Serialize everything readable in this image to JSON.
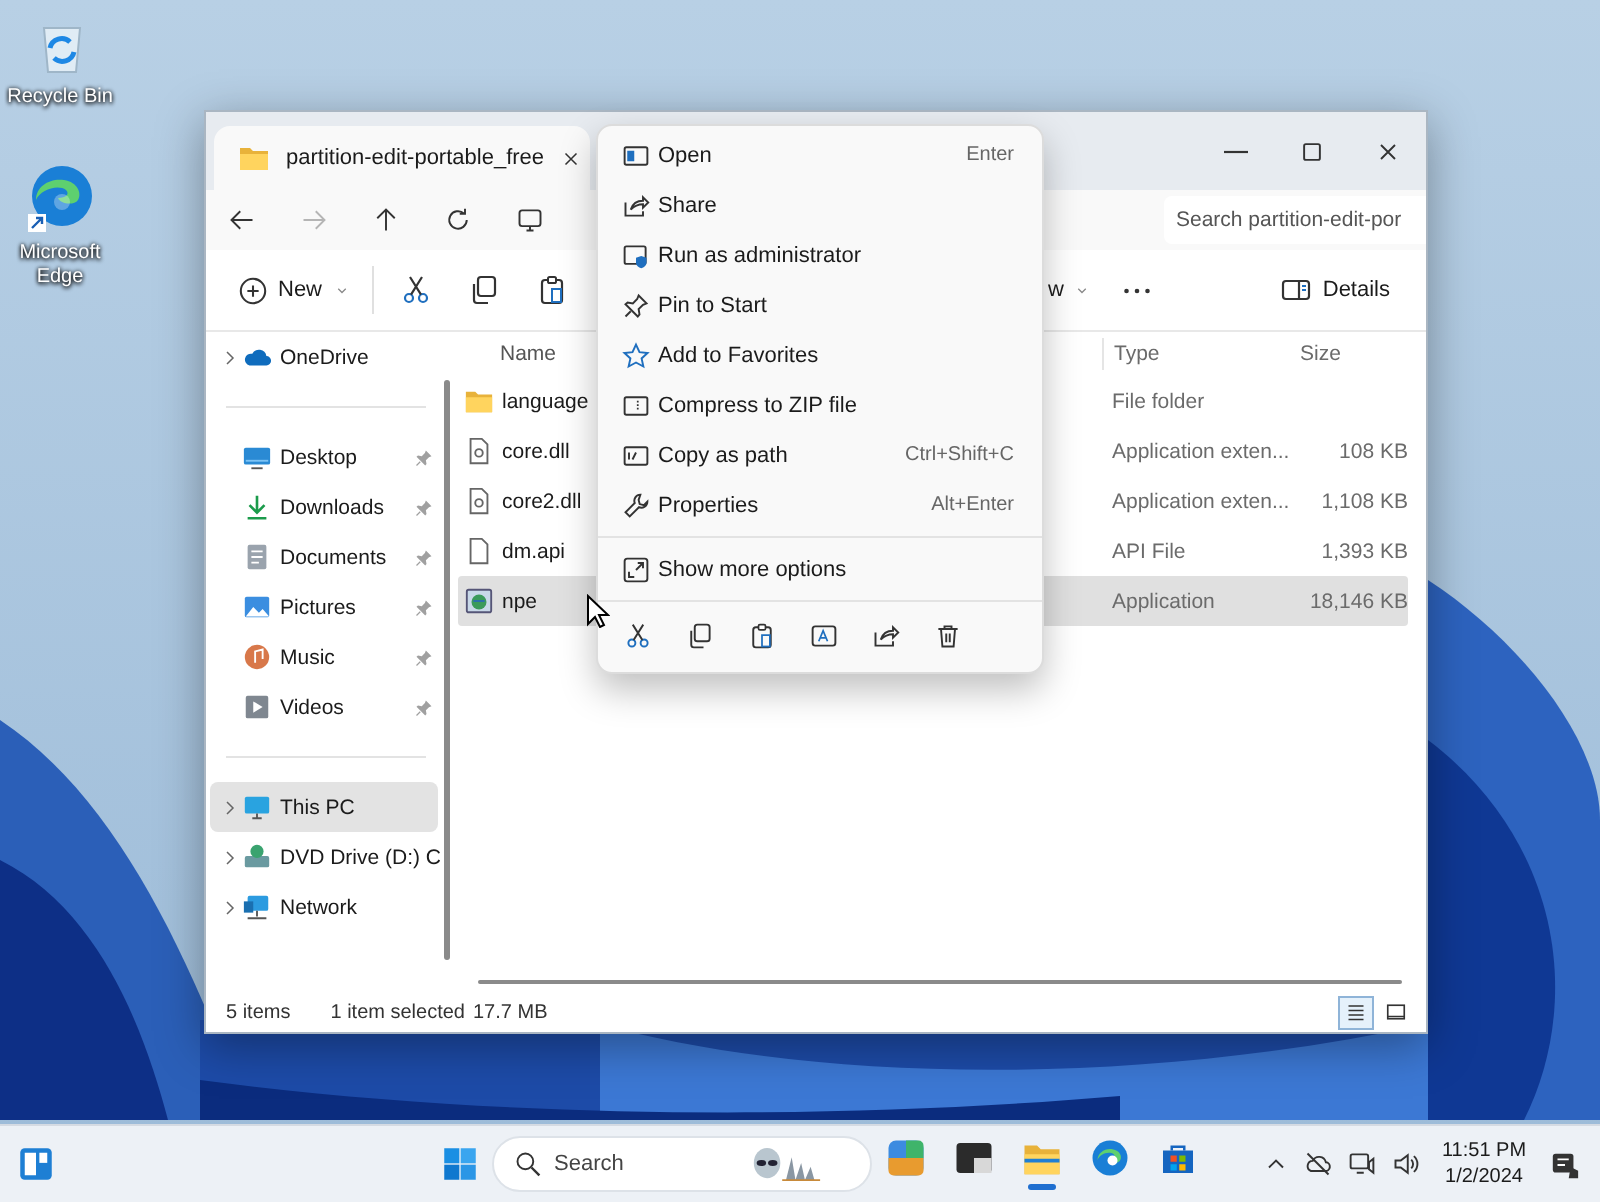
{
  "desktop_icons": [
    {
      "label": "Recycle Bin"
    },
    {
      "label": "Microsoft Edge"
    }
  ],
  "window": {
    "tab_title": "partition-edit-portable_free",
    "search": {
      "placeholder": "Search partition-edit-por"
    },
    "command_bar": {
      "new_label": "New",
      "view_label": "w",
      "details_label": "Details"
    },
    "nav_pane": {
      "sections": [
        {
          "items": [
            {
              "label": "OneDrive",
              "expandable": true,
              "pinned": false,
              "selected": false
            }
          ]
        },
        {
          "items": [
            {
              "label": "Desktop",
              "expandable": false,
              "pinned": true,
              "selected": false
            },
            {
              "label": "Downloads",
              "expandable": false,
              "pinned": true,
              "selected": false
            },
            {
              "label": "Documents",
              "expandable": false,
              "pinned": true,
              "selected": false
            },
            {
              "label": "Pictures",
              "expandable": false,
              "pinned": true,
              "selected": false
            },
            {
              "label": "Music",
              "expandable": false,
              "pinned": true,
              "selected": false
            },
            {
              "label": "Videos",
              "expandable": false,
              "pinned": true,
              "selected": false
            }
          ]
        },
        {
          "items": [
            {
              "label": "This PC",
              "expandable": true,
              "pinned": false,
              "selected": true
            },
            {
              "label": "DVD Drive (D:) C",
              "expandable": true,
              "pinned": false,
              "selected": false
            },
            {
              "label": "Network",
              "expandable": true,
              "pinned": false,
              "selected": false
            }
          ]
        }
      ]
    },
    "file_list": {
      "columns": [
        "Name",
        "Type",
        "Size"
      ],
      "rows": [
        {
          "kind": "folder",
          "name": "language",
          "type": "File folder",
          "selected": false
        },
        {
          "kind": "dll",
          "name": "core.dll",
          "type": "Application exten...",
          "size": "108 KB",
          "selected": false
        },
        {
          "kind": "dll",
          "name": "core2.dll",
          "type": "Application exten...",
          "size": "1,108 KB",
          "selected": false
        },
        {
          "kind": "file",
          "name": "dm.api",
          "type": "API File",
          "size": "1,393 KB",
          "selected": false
        },
        {
          "kind": "app",
          "name": "npe",
          "type": "Application",
          "size": "18,146 KB",
          "selected": true
        }
      ]
    },
    "status_bar": {
      "item_count": "5 items",
      "selection": "1 item selected",
      "selection_size": "17.7 MB",
      "views": [
        {
          "selected": true
        },
        {
          "selected": false
        }
      ]
    }
  },
  "context_menu": {
    "items": [
      {
        "label": "Open",
        "shortcut": "Enter"
      },
      {
        "label": "Share"
      },
      {
        "label": "Run as administrator"
      },
      {
        "label": "Pin to Start"
      },
      {
        "label": "Add to Favorites"
      },
      {
        "label": "Compress to ZIP file"
      },
      {
        "label": "Copy as path",
        "shortcut": "Ctrl+Shift+C"
      },
      {
        "label": "Properties",
        "shortcut": "Alt+Enter"
      }
    ],
    "more_options": "Show more options"
  },
  "taskbar": {
    "search": {
      "placeholder": "Search"
    },
    "apps": [
      {
        "active": false
      },
      {
        "active": false
      },
      {
        "active": true
      },
      {
        "active": false
      },
      {
        "active": false
      }
    ],
    "clock": {
      "time": "11:51 PM",
      "date": "1/2/2024"
    }
  }
}
